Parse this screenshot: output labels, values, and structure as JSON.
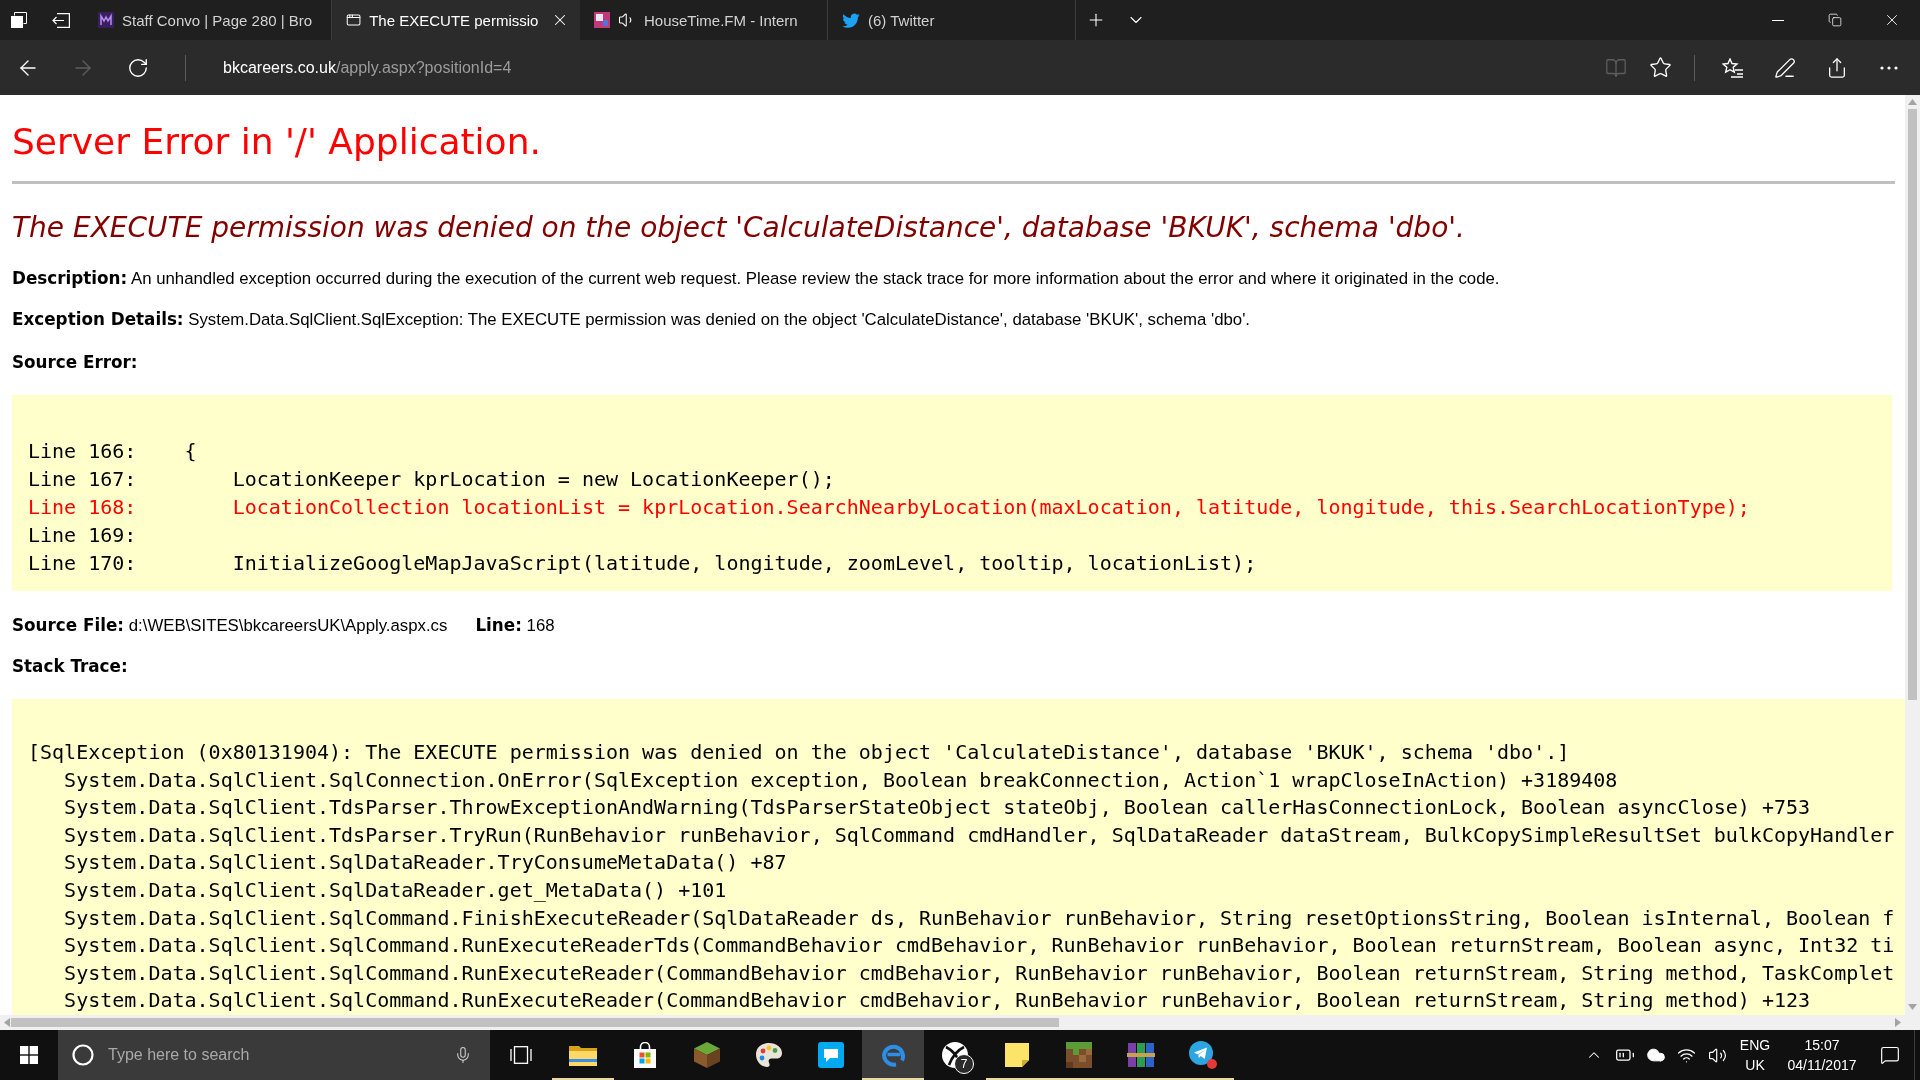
{
  "browser": {
    "tabs": [
      {
        "title": "Staff Convo | Page 280 | Bro",
        "selected": false,
        "audio": false
      },
      {
        "title": "The EXECUTE permissio",
        "selected": true,
        "audio": false
      },
      {
        "title": "HouseTime.FM - Intern",
        "selected": false,
        "audio": true
      },
      {
        "title": "(6) Twitter",
        "selected": false,
        "audio": false
      }
    ],
    "nav_buttons": [
      {
        "kind": "back",
        "disabled": false
      },
      {
        "kind": "forward",
        "disabled": true
      },
      {
        "kind": "refresh",
        "disabled": false
      }
    ],
    "address": {
      "host": "bkcareers.co.uk",
      "path": "/apply.aspx?positionId=4"
    },
    "toolbar_buttons": [
      {
        "kind": "reading",
        "disabled": true
      },
      {
        "kind": "favorite",
        "disabled": false
      },
      {
        "kind": "hub",
        "disabled": false
      },
      {
        "kind": "notes",
        "disabled": false
      },
      {
        "kind": "share",
        "disabled": false
      },
      {
        "kind": "more",
        "disabled": false
      }
    ]
  },
  "page": {
    "title": "Server Error in '/' Application.",
    "message": "The EXECUTE permission was denied on the object 'CalculateDistance', database 'BKUK', schema 'dbo'.",
    "description": {
      "label": "Description:",
      "text": "An unhandled exception occurred during the execution of the current web request. Please review the stack trace for more information about the error and where it originated in the code."
    },
    "exception_details": {
      "label": "Exception Details:",
      "text": "System.Data.SqlClient.SqlException: The EXECUTE permission was denied on the object 'CalculateDistance', database 'BKUK', schema 'dbo'."
    },
    "source_error": {
      "label": "Source Error:",
      "lines": [
        {
          "text": "Line 166:    {",
          "error": false
        },
        {
          "text": "Line 167:        LocationKeeper kprLocation = new LocationKeeper();",
          "error": false
        },
        {
          "text": "Line 168:        LocationCollection locationList = kprLocation.SearchNearbyLocation(maxLocation, latitude, longitude, this.SearchLocationType);",
          "error": true
        },
        {
          "text": "Line 169:",
          "error": false
        },
        {
          "text": "Line 170:        InitializeGoogleMapJavaScript(latitude, longitude, zoomLevel, tooltip, locationList);",
          "error": false
        }
      ]
    },
    "source_file": {
      "label": "Source File:",
      "path": "d:\\WEB\\SITES\\bkcareersUK\\Apply.aspx.cs",
      "line_label": "Line:",
      "line": "168"
    },
    "stack_trace": {
      "label": "Stack Trace:",
      "lines": [
        {
          "text": "[SqlException (0x80131904): The EXECUTE permission was denied on the object 'CalculateDistance', database 'BKUK', schema 'dbo'.]",
          "children": [
            {
              "text": "System.Data.SqlClient.SqlConnection.OnError(SqlException exception, Boolean breakConnection, Action`1 wrapCloseInAction) +3189408"
            },
            {
              "text": "System.Data.SqlClient.TdsParser.ThrowExceptionAndWarning(TdsParserStateObject stateObj, Boolean callerHasConnectionLock, Boolean asyncClose) +753"
            },
            {
              "text": "System.Data.SqlClient.TdsParser.TryRun(RunBehavior runBehavior, SqlCommand cmdHandler, SqlDataReader dataStream, BulkCopySimpleResultSet bulkCopyHandler"
            },
            {
              "text": "System.Data.SqlClient.SqlDataReader.TryConsumeMetaData() +87"
            },
            {
              "text": "System.Data.SqlClient.SqlDataReader.get_MetaData() +101"
            },
            {
              "text": "System.Data.SqlClient.SqlCommand.FinishExecuteReader(SqlDataReader ds, RunBehavior runBehavior, String resetOptionsString, Boolean isInternal, Boolean f"
            },
            {
              "text": "System.Data.SqlClient.SqlCommand.RunExecuteReaderTds(CommandBehavior cmdBehavior, RunBehavior runBehavior, Boolean returnStream, Boolean async, Int32 ti"
            },
            {
              "text": "System.Data.SqlClient.SqlCommand.RunExecuteReader(CommandBehavior cmdBehavior, RunBehavior runBehavior, Boolean returnStream, String method, TaskComplet"
            },
            {
              "text": "System.Data.SqlClient.SqlCommand.RunExecuteReader(CommandBehavior cmdBehavior, RunBehavior runBehavior, Boolean returnStream, String method) +123"
            }
          ]
        }
      ]
    }
  },
  "taskbar": {
    "search": {
      "placeholder": "Type here to search"
    },
    "apps": [
      {
        "kind": "folder",
        "running": true,
        "selected": false
      },
      {
        "kind": "bag",
        "running": false,
        "selected": false
      },
      {
        "kind": "cube",
        "running": false,
        "selected": false
      },
      {
        "kind": "palette",
        "running": false,
        "selected": false
      },
      {
        "kind": "chat",
        "running": false,
        "selected": false
      },
      {
        "kind": "swirl",
        "running": true,
        "selected": true
      },
      {
        "kind": "sphere",
        "running": false,
        "selected": false,
        "badge": "7"
      },
      {
        "kind": "note",
        "running": true,
        "selected": false
      },
      {
        "kind": "block",
        "running": true,
        "selected": false
      },
      {
        "kind": "books",
        "running": true,
        "selected": false
      },
      {
        "kind": "plane",
        "running": true,
        "selected": false
      }
    ],
    "language": "ENG",
    "region": "UK",
    "time": "15:07",
    "date": "04/11/2017"
  }
}
